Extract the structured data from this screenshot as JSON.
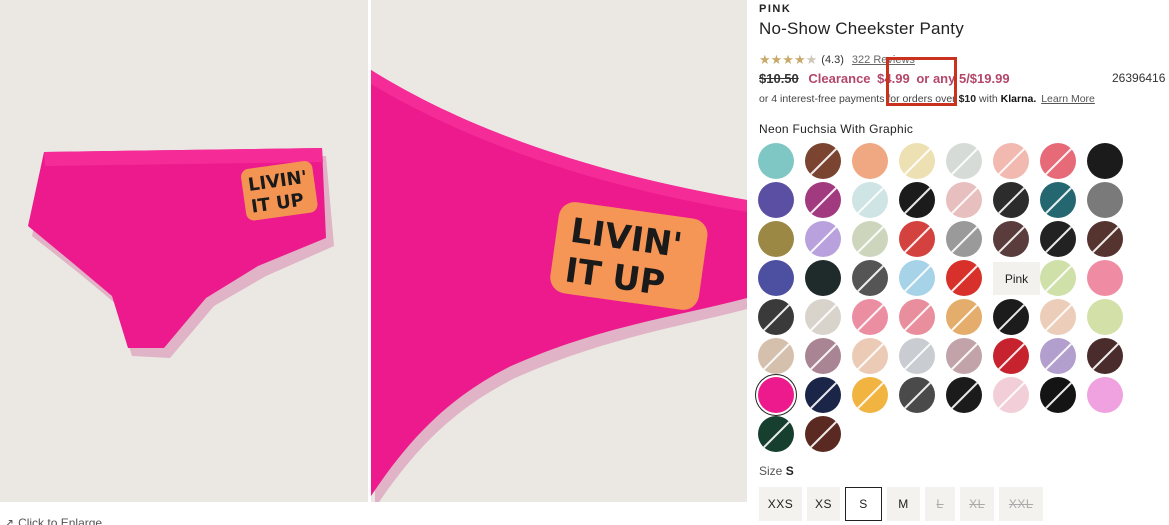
{
  "product": {
    "brand": "PINK",
    "title": "No-Show Cheekster Panty",
    "rating_value": "(4.3)",
    "rating_stars": 4.3,
    "reviews": "322 Reviews",
    "original_price": "$10.50",
    "clearance_prefix": "Clearance",
    "clearance_price": "$4.99",
    "clearance_suffix": "or any 5/$19.99",
    "sku": "26396416",
    "klarna_text": "or 4 interest-free payments for orders over",
    "klarna_amount": "$10",
    "klarna_with": "with",
    "klarna_brand": "Klarna.",
    "klarna_link": "Learn More"
  },
  "gallery": {
    "graphic_text_line1": "LIVIN'",
    "graphic_text_line2": "IT UP",
    "enlarge_label": "Click to Enlarge"
  },
  "color": {
    "selected_label": "Neon Fuchsia With Graphic",
    "tooltip": "Pink",
    "accent": "#ec1a8c"
  },
  "swatches": [
    {
      "color": "#7fc7c4",
      "oos": false
    },
    {
      "color": "#7a4430",
      "oos": true
    },
    {
      "color": "#f0a882",
      "oos": false
    },
    {
      "color": "#ede0b2",
      "oos": true
    },
    {
      "color": "#d7dbd8",
      "oos": true
    },
    {
      "color": "#f2b9b1",
      "oos": true
    },
    {
      "color": "#e66a78",
      "oos": true
    },
    {
      "color": "#1b1b1b",
      "oos": false
    },
    {
      "color": "#5a4fa3",
      "oos": false
    },
    {
      "color": "#a23a7f",
      "oos": true
    },
    {
      "color": "#cfe4e4",
      "oos": true
    },
    {
      "color": "#1b1b1b",
      "oos": true
    },
    {
      "color": "#e8bfbf",
      "oos": true
    },
    {
      "color": "#2c2c2c",
      "oos": true
    },
    {
      "color": "#246770",
      "oos": true
    },
    {
      "color": "#7a7a7a",
      "oos": false
    },
    {
      "color": "#9b8845",
      "oos": false
    },
    {
      "color": "#b9a1dd",
      "oos": true
    },
    {
      "color": "#cdd6bd",
      "oos": true
    },
    {
      "color": "#d4423f",
      "oos": true
    },
    {
      "color": "#9a9a9a",
      "oos": true
    },
    {
      "color": "#5b3c3c",
      "oos": true
    },
    {
      "color": "#222222",
      "oos": true
    },
    {
      "color": "#55332f",
      "oos": true
    },
    {
      "color": "#4d4fa1",
      "oos": false
    },
    {
      "color": "#1f2a2a",
      "oos": false
    },
    {
      "color": "#555555",
      "oos": true
    },
    {
      "color": "#a7d3e8",
      "oos": true
    },
    {
      "color": "#d8312b",
      "oos": true
    },
    {
      "color": "#ffffff",
      "oos": false
    },
    {
      "color": "#cfe0a8",
      "oos": true
    },
    {
      "color": "#ef8ca4",
      "oos": false
    },
    {
      "color": "#3a3a3a",
      "oos": true
    },
    {
      "color": "#d8d4cc",
      "oos": true
    },
    {
      "color": "#ec8ea2",
      "oos": true
    },
    {
      "color": "#e88e9d",
      "oos": true
    },
    {
      "color": "#e5ad6c",
      "oos": true
    },
    {
      "color": "#1c1c1c",
      "oos": true
    },
    {
      "color": "#ebcdb9",
      "oos": true
    },
    {
      "color": "#d3e1a8",
      "oos": false
    },
    {
      "color": "#d5c0ae",
      "oos": true
    },
    {
      "color": "#a98593",
      "oos": true
    },
    {
      "color": "#ebcbb6",
      "oos": true
    },
    {
      "color": "#c9ccd0",
      "oos": true
    },
    {
      "color": "#c2a3a9",
      "oos": true
    },
    {
      "color": "#c6232f",
      "oos": true
    },
    {
      "color": "#b29fcd",
      "oos": true
    },
    {
      "color": "#4a2c2c",
      "oos": true
    },
    {
      "color": "#ec1a8c",
      "oos": false,
      "selected": true
    },
    {
      "color": "#1b2548",
      "oos": true
    },
    {
      "color": "#f1b441",
      "oos": true
    },
    {
      "color": "#4a4a4a",
      "oos": true
    },
    {
      "color": "#1b1b1b",
      "oos": true
    },
    {
      "color": "#f2cfd8",
      "oos": true
    },
    {
      "color": "#141414",
      "oos": true
    },
    {
      "color": "#efa2df",
      "oos": false
    },
    {
      "color": "#173f30",
      "oos": true
    },
    {
      "color": "#5a2a22",
      "oos": true
    }
  ],
  "size": {
    "label": "Size",
    "selected": "S",
    "options": [
      {
        "label": "XXS",
        "available": true,
        "selected": false
      },
      {
        "label": "XS",
        "available": true,
        "selected": false
      },
      {
        "label": "S",
        "available": true,
        "selected": true
      },
      {
        "label": "M",
        "available": true,
        "selected": false
      },
      {
        "label": "L",
        "available": false,
        "selected": false
      },
      {
        "label": "XL",
        "available": false,
        "selected": false
      },
      {
        "label": "XXL",
        "available": false,
        "selected": false
      }
    ]
  }
}
